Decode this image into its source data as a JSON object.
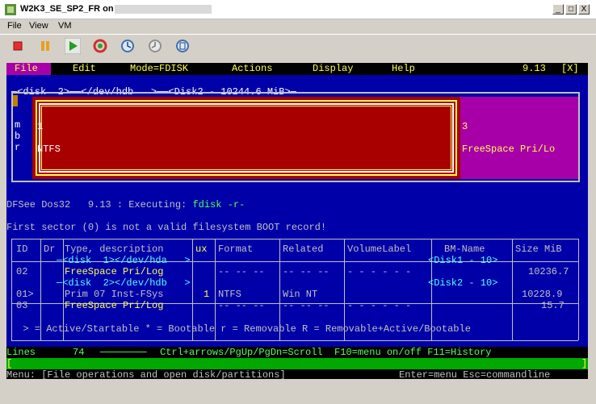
{
  "window": {
    "title": "W2K3_SE_SP2_FR on",
    "buttons": [
      "_",
      "□",
      "X"
    ]
  },
  "menubar": {
    "items": [
      "File",
      "View",
      "VM"
    ]
  },
  "toolbar": {
    "buttons": [
      {
        "name": "stop",
        "icon": "stop-icon",
        "color": "#e03030"
      },
      {
        "name": "pause",
        "icon": "pause-icon",
        "color": "#e8a020"
      },
      {
        "name": "play",
        "icon": "play-icon",
        "color": "#20a020"
      },
      {
        "name": "reset",
        "icon": "reset-icon",
        "color": "#d03030"
      },
      {
        "name": "snapshot",
        "icon": "snapshot-icon"
      },
      {
        "name": "revert",
        "icon": "revert-icon"
      },
      {
        "name": "manage",
        "icon": "manage-snapshots-icon"
      }
    ]
  },
  "console": {
    "menu": {
      "file": "File",
      "edit": "Edit",
      "mode": "Mode=FDISK",
      "actions": "Actions",
      "display": "Display",
      "help": "Help",
      "version": "9.13",
      "close": "[X]"
    },
    "disk_header": "─<disk  2>──</dev/hdb   >──<Disk2 - 10244.6 MiB>─",
    "partmap": {
      "mbr_letters": [
        "m",
        "b",
        "r"
      ],
      "p1_num": "1",
      "p1_fs": "NTFS",
      "p3_num": "3",
      "p3_fs": "FreeSpace Pri/Lo"
    },
    "exec_prefix": "DFSee Dos32   9.13 : Executing: ",
    "exec_cmd": "fdisk -r-",
    "message": "First sector (0) is not a valid filesystem BOOT record!",
    "table": {
      "headers": [
        "ID",
        "Dr",
        "Type, description",
        "ux",
        "Format",
        "Related",
        "VolumeLabel",
        "BM-Name",
        "Size MiB"
      ],
      "disk1_row": "─<disk  1></dev/hda   >",
      "disk1_bm": "<Disk1 - 10>",
      "disk1_dashes_format": "-- -- --",
      "disk1_dashes_related": "-- -- --",
      "disk1_dashes_label": "- - - - - -",
      "rows_disk1": [
        {
          "id": "02",
          "type": "FreeSpace Pri/Log",
          "size": "10236.7"
        }
      ],
      "disk2_row": "─<disk  2></dev/hdb   >",
      "disk2_bm": "<Disk2 - 10>",
      "rows_disk2": [
        {
          "id": "01>",
          "type": "Prim 07 Inst-FSys",
          "ux": "1",
          "format": "NTFS",
          "related": "Win NT",
          "size": "10228.9"
        },
        {
          "id": "03",
          "type": "FreeSpace Pri/Log",
          "format": "-- -- --",
          "related": "-- -- --",
          "label": "- - - - - -",
          "size": "15.7"
        }
      ]
    },
    "legend": "  > = Active/Startable * = Bootable r = Removable R = Removable+Active/Bootable",
    "lines_bar": {
      "label": "Lines",
      "count": "74",
      "hint": "Ctrl+arrows/PgUp/PgDn=Scroll  F10=menu on/off F11=History"
    },
    "input_line": "[",
    "input_close": "]",
    "status": {
      "left": "Menu: [File operations and open disk/partitions]",
      "right": "Enter=menu Esc=commandline"
    }
  }
}
